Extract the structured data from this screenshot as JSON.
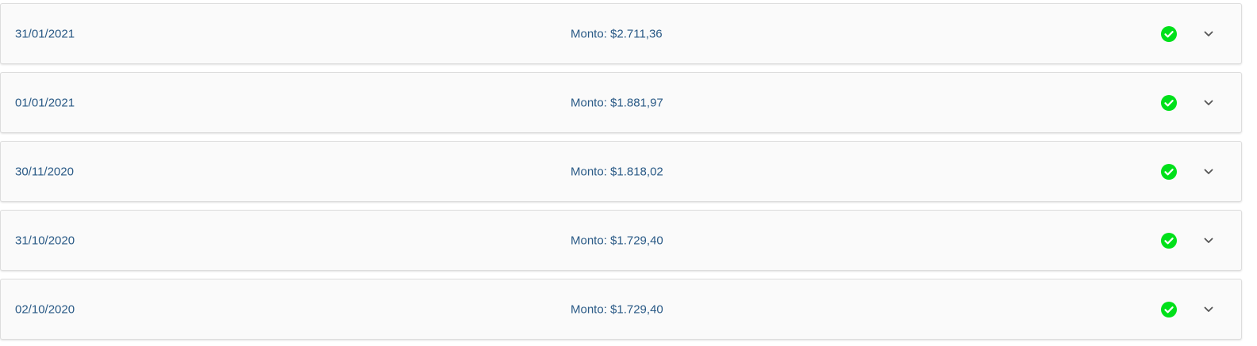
{
  "colors": {
    "text": "#2a5a86",
    "status_ok": "#00e01a",
    "chevron": "#555555",
    "row_bg": "#fafafa",
    "row_border": "#dddddd"
  },
  "icons": {
    "status": "check-circle-icon",
    "expand": "chevron-down-icon"
  },
  "payments": [
    {
      "date": "31/01/2021",
      "amount": "Monto: $2.711,36",
      "status": "paid"
    },
    {
      "date": "01/01/2021",
      "amount": "Monto: $1.881,97",
      "status": "paid"
    },
    {
      "date": "30/11/2020",
      "amount": "Monto: $1.818,02",
      "status": "paid"
    },
    {
      "date": "31/10/2020",
      "amount": "Monto: $1.729,40",
      "status": "paid"
    },
    {
      "date": "02/10/2020",
      "amount": "Monto: $1.729,40",
      "status": "paid"
    }
  ]
}
